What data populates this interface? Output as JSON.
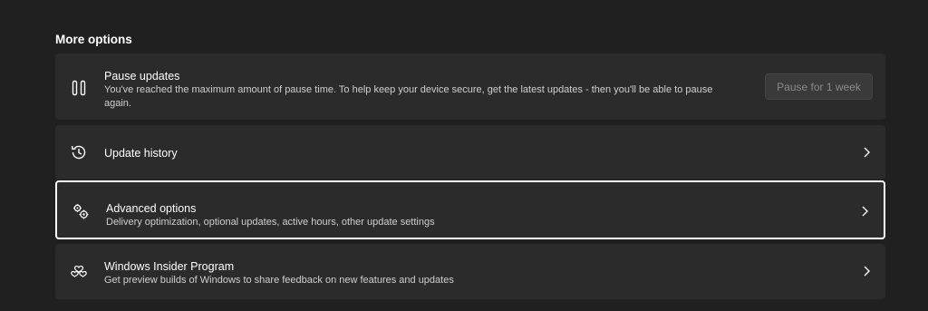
{
  "section_title": "More options",
  "pause": {
    "title": "Pause updates",
    "description": "You've reached the maximum amount of pause time. To help keep your device secure, get the latest updates - then you'll be able to pause again.",
    "button_label": "Pause for 1 week",
    "icon": "pause-icon"
  },
  "history": {
    "title": "Update history",
    "icon": "history-icon"
  },
  "advanced": {
    "title": "Advanced options",
    "description": "Delivery optimization, optional updates, active hours, other update settings",
    "icon": "gears-icon"
  },
  "insider": {
    "title": "Windows Insider Program",
    "description": "Get preview builds of Windows to share feedback on new features and updates",
    "icon": "insider-hearts-icon"
  },
  "colors": {
    "background": "#202020",
    "card": "#2b2b2b",
    "logo_blue": "#2d7fd8",
    "logo_orange": "#f4a020"
  }
}
